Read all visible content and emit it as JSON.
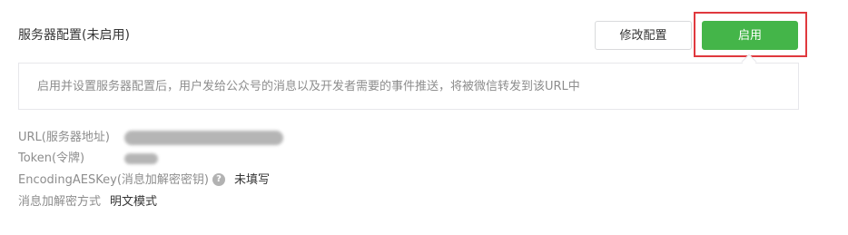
{
  "header": {
    "title": "服务器配置(未启用)",
    "modify_label": "修改配置",
    "enable_label": "启用"
  },
  "tip": {
    "text": "启用并设置服务器配置后，用户发给公众号的消息以及开发者需要的事件推送，将被微信转发到该URL中"
  },
  "fields": {
    "url_label": "URL(服务器地址)",
    "token_label": "Token(令牌)",
    "aes_label": "EncodingAESKey(消息加解密密钥)",
    "aes_help_glyph": "?",
    "aes_value": "未填写",
    "mode_label": "消息加解密方式",
    "mode_value": "明文模式"
  },
  "colors": {
    "primary_green": "#44b549",
    "highlight_red": "#e0393e",
    "label_gray": "#8d8d8d",
    "text_dark": "#353535"
  },
  "icons": {
    "help": "help-icon"
  }
}
